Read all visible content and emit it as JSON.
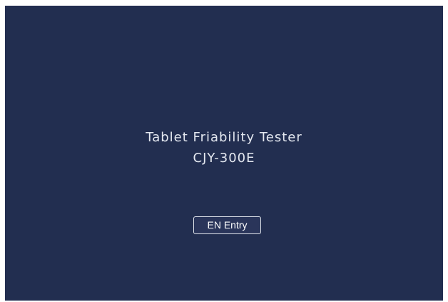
{
  "splash": {
    "title": "Tablet Friability Tester",
    "model": "CJY-300E",
    "entry_button_label": "EN Entry"
  },
  "colors": {
    "background": "#222e50",
    "text": "#e4e8f0",
    "button_border": "#dfe3ea"
  }
}
